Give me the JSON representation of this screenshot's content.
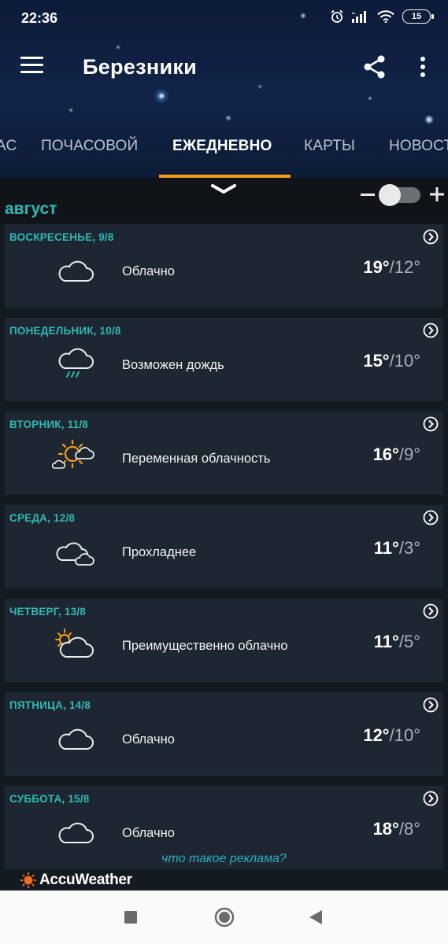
{
  "status": {
    "time": "22:36",
    "battery": "15"
  },
  "app": {
    "city": "Березники"
  },
  "tabs": [
    "АС",
    "ПОЧАСОВОЙ",
    "ЕЖЕДНЕВНО",
    "КАРТЫ",
    "НОВОСТ"
  ],
  "active_tab": "ЕЖЕДНЕВНО",
  "month": "август",
  "zoom": {
    "minus": "−",
    "plus": "+"
  },
  "days": [
    {
      "day": "ВОСКРЕСЕНЬЕ, 9/8",
      "phrase": "Облачно",
      "hi": "19°",
      "lo": "/12°",
      "icon": "cloud-icon"
    },
    {
      "day": "ПОНЕДЕЛЬНИК, 10/8",
      "phrase": "Возможен дождь",
      "hi": "15°",
      "lo": "/10°",
      "icon": "rain-cloud-icon"
    },
    {
      "day": "ВТОРНИК, 11/8",
      "phrase": "Переменная облачность",
      "hi": "16°",
      "lo": "/9°",
      "icon": "partly-sunny-icon"
    },
    {
      "day": "СРЕДА, 12/8",
      "phrase": "Прохладнее",
      "hi": "11°",
      "lo": "/3°",
      "icon": "clouds-icon"
    },
    {
      "day": "ЧЕТВЕРГ, 13/8",
      "phrase": "Преимущественно облачно",
      "hi": "11°",
      "lo": "/5°",
      "icon": "mostly-cloudy-icon"
    },
    {
      "day": "ПЯТНИЦА, 14/8",
      "phrase": "Облачно",
      "hi": "12°",
      "lo": "/10°",
      "icon": "cloud-icon"
    },
    {
      "day": "СУББОТА, 15/8",
      "phrase": "Облачно",
      "hi": "18°",
      "lo": "/8°",
      "icon": "cloud-icon"
    }
  ],
  "ad": {
    "link": "что такое реклама?"
  },
  "brand": {
    "name": "AccuWeather"
  },
  "colors": {
    "accent": "#2fb9b5",
    "tab_indicator": "#f39c1e",
    "card_bg": "#1d2631",
    "sun": "#f39c1e"
  }
}
